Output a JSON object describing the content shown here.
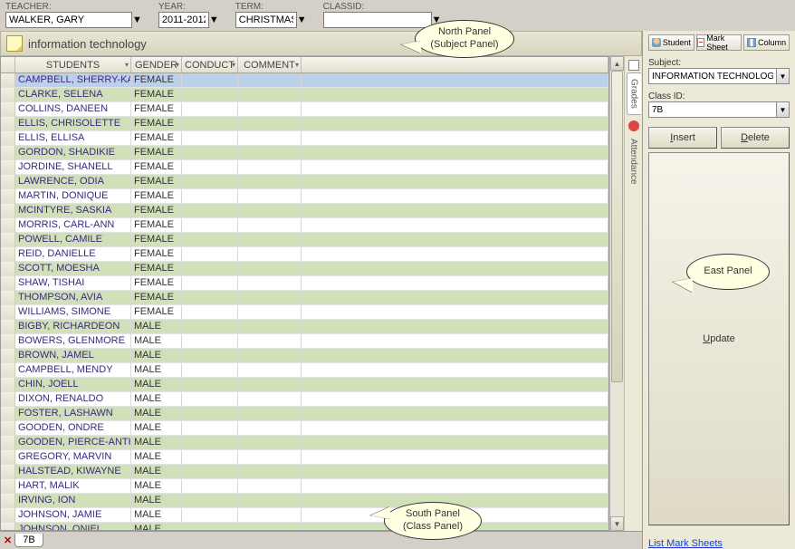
{
  "topbar": {
    "teacher_label": "TEACHER:",
    "teacher_value": "WALKER, GARY",
    "year_label": "YEAR:",
    "year_value": "2011-2012",
    "term_label": "TERM:",
    "term_value": "CHRISTMAS",
    "classid_label": "CLASSID:",
    "classid_value": ""
  },
  "subject_panel": {
    "title": "information technology"
  },
  "grid": {
    "headers": {
      "students": "STUDENTS",
      "gender": "GENDER",
      "conduct": "CONDUCT",
      "comment": "COMMENT"
    },
    "rows": [
      {
        "name": "CAMPBELL, SHERRY-KAYE",
        "gender": "FEMALE",
        "alt": false,
        "selected": true
      },
      {
        "name": "CLARKE, SELENA",
        "gender": "FEMALE",
        "alt": true
      },
      {
        "name": "COLLINS, DANEEN",
        "gender": "FEMALE",
        "alt": false
      },
      {
        "name": "ELLIS, CHRISOLETTE",
        "gender": "FEMALE",
        "alt": true
      },
      {
        "name": "ELLIS, ELLISA",
        "gender": "FEMALE",
        "alt": false
      },
      {
        "name": "GORDON, SHADIKIE",
        "gender": "FEMALE",
        "alt": true
      },
      {
        "name": "JORDINE, SHANELL",
        "gender": "FEMALE",
        "alt": false
      },
      {
        "name": "LAWRENCE, ODIA",
        "gender": "FEMALE",
        "alt": true
      },
      {
        "name": "MARTIN, DONIQUE",
        "gender": "FEMALE",
        "alt": false
      },
      {
        "name": "MCINTYRE, SASKIA",
        "gender": "FEMALE",
        "alt": true
      },
      {
        "name": "MORRIS, CARL-ANN",
        "gender": "FEMALE",
        "alt": false
      },
      {
        "name": "POWELL, CAMILE",
        "gender": "FEMALE",
        "alt": true
      },
      {
        "name": "REID, DANIELLE",
        "gender": "FEMALE",
        "alt": false
      },
      {
        "name": "SCOTT, MOESHA",
        "gender": "FEMALE",
        "alt": true
      },
      {
        "name": "SHAW, TISHAI",
        "gender": "FEMALE",
        "alt": false
      },
      {
        "name": "THOMPSON, AVIA",
        "gender": "FEMALE",
        "alt": true
      },
      {
        "name": "WILLIAMS, SIMONE",
        "gender": "FEMALE",
        "alt": false
      },
      {
        "name": "BIGBY, RICHARDEON",
        "gender": "MALE",
        "alt": true
      },
      {
        "name": "BOWERS, GLENMORE",
        "gender": "MALE",
        "alt": false
      },
      {
        "name": "BROWN, JAMEL",
        "gender": "MALE",
        "alt": true
      },
      {
        "name": "CAMPBELL, MENDY",
        "gender": "MALE",
        "alt": false
      },
      {
        "name": "CHIN, JOELL",
        "gender": "MALE",
        "alt": true
      },
      {
        "name": "DIXON, RENALDO",
        "gender": "MALE",
        "alt": false
      },
      {
        "name": "FOSTER, LASHAWN",
        "gender": "MALE",
        "alt": true
      },
      {
        "name": "GOODEN, ONDRE",
        "gender": "MALE",
        "alt": false
      },
      {
        "name": "GOODEN, PIERCE-ANTHONY",
        "gender": "MALE",
        "alt": true
      },
      {
        "name": "GREGORY, MARVIN",
        "gender": "MALE",
        "alt": false
      },
      {
        "name": "HALSTEAD, KIWAYNE",
        "gender": "MALE",
        "alt": true
      },
      {
        "name": "HART, MALIK",
        "gender": "MALE",
        "alt": false
      },
      {
        "name": "IRVING, ION",
        "gender": "MALE",
        "alt": true
      },
      {
        "name": "JOHNSON, JAMIE",
        "gender": "MALE",
        "alt": false
      },
      {
        "name": "JOHNSON, ONIEL",
        "gender": "MALE",
        "alt": true
      }
    ]
  },
  "side_tabs": {
    "grades": "Grades",
    "attendance": "Attendance"
  },
  "south": {
    "close": "✕",
    "tab": "7B"
  },
  "east": {
    "btn_student": "Student",
    "btn_marksheet": "Mark Sheet",
    "btn_column": "Column",
    "subject_label": "Subject:",
    "subject_value": "INFORMATION TECHNOLOGY",
    "classid_label": "Class ID:",
    "classid_value": "7B",
    "insert": "Insert",
    "delete": "Delete",
    "update": "Update",
    "link": "List Mark Sheets"
  },
  "callouts": {
    "north_l1": "North Panel",
    "north_l2": "(Subject Panel)",
    "south_l1": "South Panel",
    "south_l2": "(Class Panel)",
    "east": "East Panel"
  }
}
